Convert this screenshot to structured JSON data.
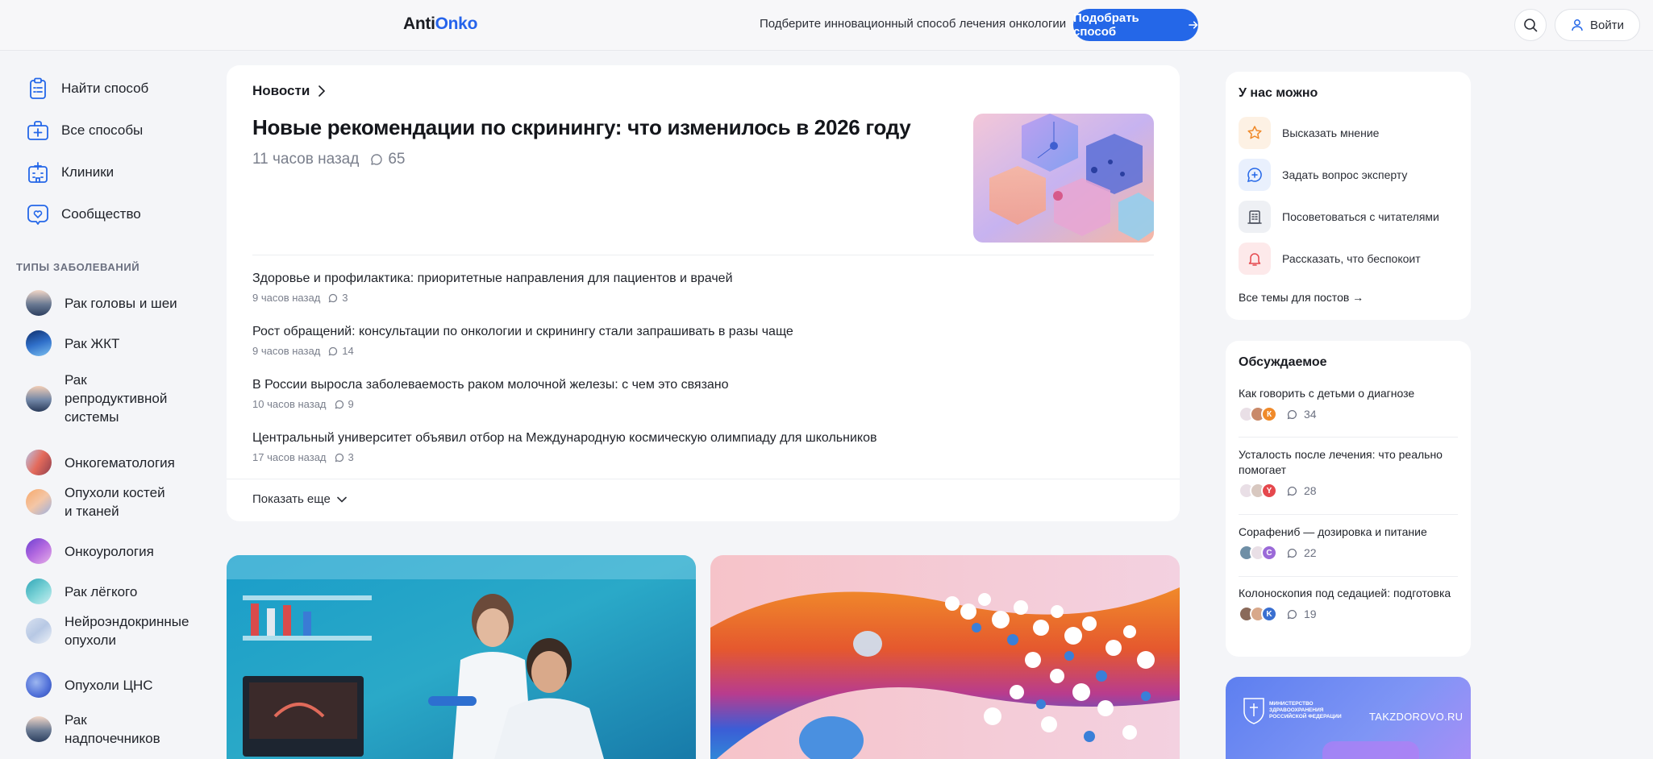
{
  "header": {
    "logo_part1": "Anti",
    "logo_part2": "Onko",
    "promo_text": "Подберите инновационный способ лечения онкологии",
    "cta_label": "Подобрать способ",
    "login_label": "Войти"
  },
  "sidebar": {
    "nav": [
      {
        "label": "Найти способ",
        "icon": "clipboard-icon"
      },
      {
        "label": "Все способы",
        "icon": "medkit-icon"
      },
      {
        "label": "Клиники",
        "icon": "hospital-icon"
      },
      {
        "label": "Сообщество",
        "icon": "heart-chat-icon"
      }
    ],
    "types_heading": "ТИПЫ ЗАБОЛЕВАНИЙ",
    "types": [
      "Рак головы и шеи",
      "Рак ЖКТ",
      "Рак репродуктивной системы",
      "Онкогематология",
      "Опухоли костей и тканей",
      "Онкоурология",
      "Рак лёгкого",
      "Нейроэндокринные опухоли",
      "Опухоли ЦНС",
      "Рак надпочечников"
    ]
  },
  "news": {
    "heading": "Новости",
    "lead": {
      "title": "Новые рекомендации по скринингу: что изменилось в 2026 году",
      "time": "11 часов назад",
      "comments": "65"
    },
    "items": [
      {
        "title": "Здоровье и профилактика: приоритетные направления для пациентов и врачей",
        "time": "9 часов назад",
        "comments": "3"
      },
      {
        "title": "Рост обращений: консультации по онкологии и скринингу стали запрашивать в разы чаще",
        "time": "9 часов назад",
        "comments": "14"
      },
      {
        "title": "В России выросла заболеваемость раком молочной железы: с чем это связано",
        "time": "10 часов назад",
        "comments": "9"
      },
      {
        "title": "Центральный университет объявил отбор на Международную космическую олимпиаду для школьников",
        "time": "17 часов назад",
        "comments": "3"
      }
    ],
    "show_more": "Показать еще"
  },
  "can_do": {
    "title": "У нас можно",
    "items": [
      {
        "label": "Высказать мнение",
        "icon": "star-icon"
      },
      {
        "label": "Задать вопрос эксперту",
        "icon": "chat-plus-icon"
      },
      {
        "label": "Посоветоваться с читателями",
        "icon": "building-icon"
      },
      {
        "label": "Рассказать, что беспокоит",
        "icon": "bell-icon"
      }
    ],
    "all_topics": "Все темы для постов →"
  },
  "discussed": {
    "title": "Обсуждаемое",
    "items": [
      {
        "title": "Как говорить с детьми о диагнозе",
        "avatar_letter": "К",
        "comments": "34"
      },
      {
        "title": "Усталость после лечения: что реально помогает",
        "avatar_letter": "Y",
        "comments": "28"
      },
      {
        "title": "Сорафениб — дозировка и питание",
        "avatar_letter": "C",
        "comments": "22"
      },
      {
        "title": "Колоноскопия под седацией: подготовка",
        "avatar_letter": "K",
        "comments": "19"
      }
    ]
  },
  "ad": {
    "ministry": "МИНИСТЕРСТВО ЗДРАВООХРАНЕНИЯ РОССИЙСКОЙ ФЕДЕРАЦИИ",
    "site": "TAKZDOROVO.RU"
  },
  "colors": {
    "accent": "#2467e8",
    "background": "#f4f5f8"
  }
}
